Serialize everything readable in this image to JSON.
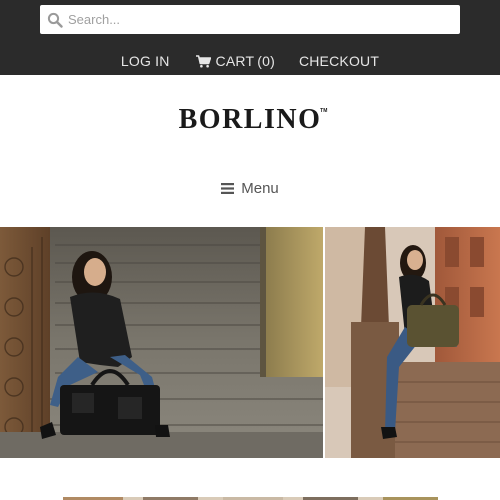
{
  "search": {
    "placeholder": "Search..."
  },
  "nav": {
    "login_label": "LOG IN",
    "cart_label": "CART",
    "cart_count": "(0)",
    "checkout_label": "CHECKOUT"
  },
  "logo": {
    "text": "BORLINO",
    "tm": "TM"
  },
  "menu": {
    "label": "Menu"
  },
  "icons": {
    "search": "search-icon",
    "cart": "shopping-cart-icon",
    "menu": "hamburger-icon"
  },
  "colors": {
    "topbar_bg": "#2b2b2b",
    "nav_text": "#e6e6e6",
    "logo_text": "#1a1a1a",
    "menu_text": "#555555"
  }
}
